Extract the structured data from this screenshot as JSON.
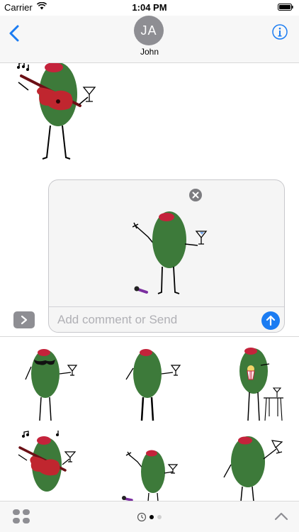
{
  "status_bar": {
    "carrier": "Carrier",
    "time": "1:04 PM",
    "wifi_icon": "wifi-icon",
    "battery_icon": "battery-icon"
  },
  "header": {
    "back_icon": "chevron-left-icon",
    "avatar_initials": "JA",
    "contact_name": "John",
    "info_icon": "info-icon"
  },
  "compose": {
    "placeholder": "Add comment or Send",
    "send_icon": "arrow-up-icon",
    "remove_icon": "close-icon",
    "expand_icon": "chevron-right-icon"
  },
  "stickers": {
    "sent": "olive-guitar-sticker",
    "preview": "olive-mic-drop-sticker",
    "drawer": [
      "olive-sunglasses-martini-sticker",
      "olive-martini-sticker",
      "olive-popcorn-table-sticker",
      "olive-guitar-sticker",
      "olive-mic-drop-sticker",
      "olive-toast-sticker"
    ]
  },
  "bottom_bar": {
    "apps_icon": "app-grid-icon",
    "recents_icon": "clock-icon",
    "collapse_icon": "chevron-up-icon"
  },
  "colors": {
    "accent": "#1b7cf2",
    "olive": "#3d7a3a",
    "pimento": "#c4233b",
    "guitar": "#c0262f",
    "avatar": "#8e8e93"
  }
}
